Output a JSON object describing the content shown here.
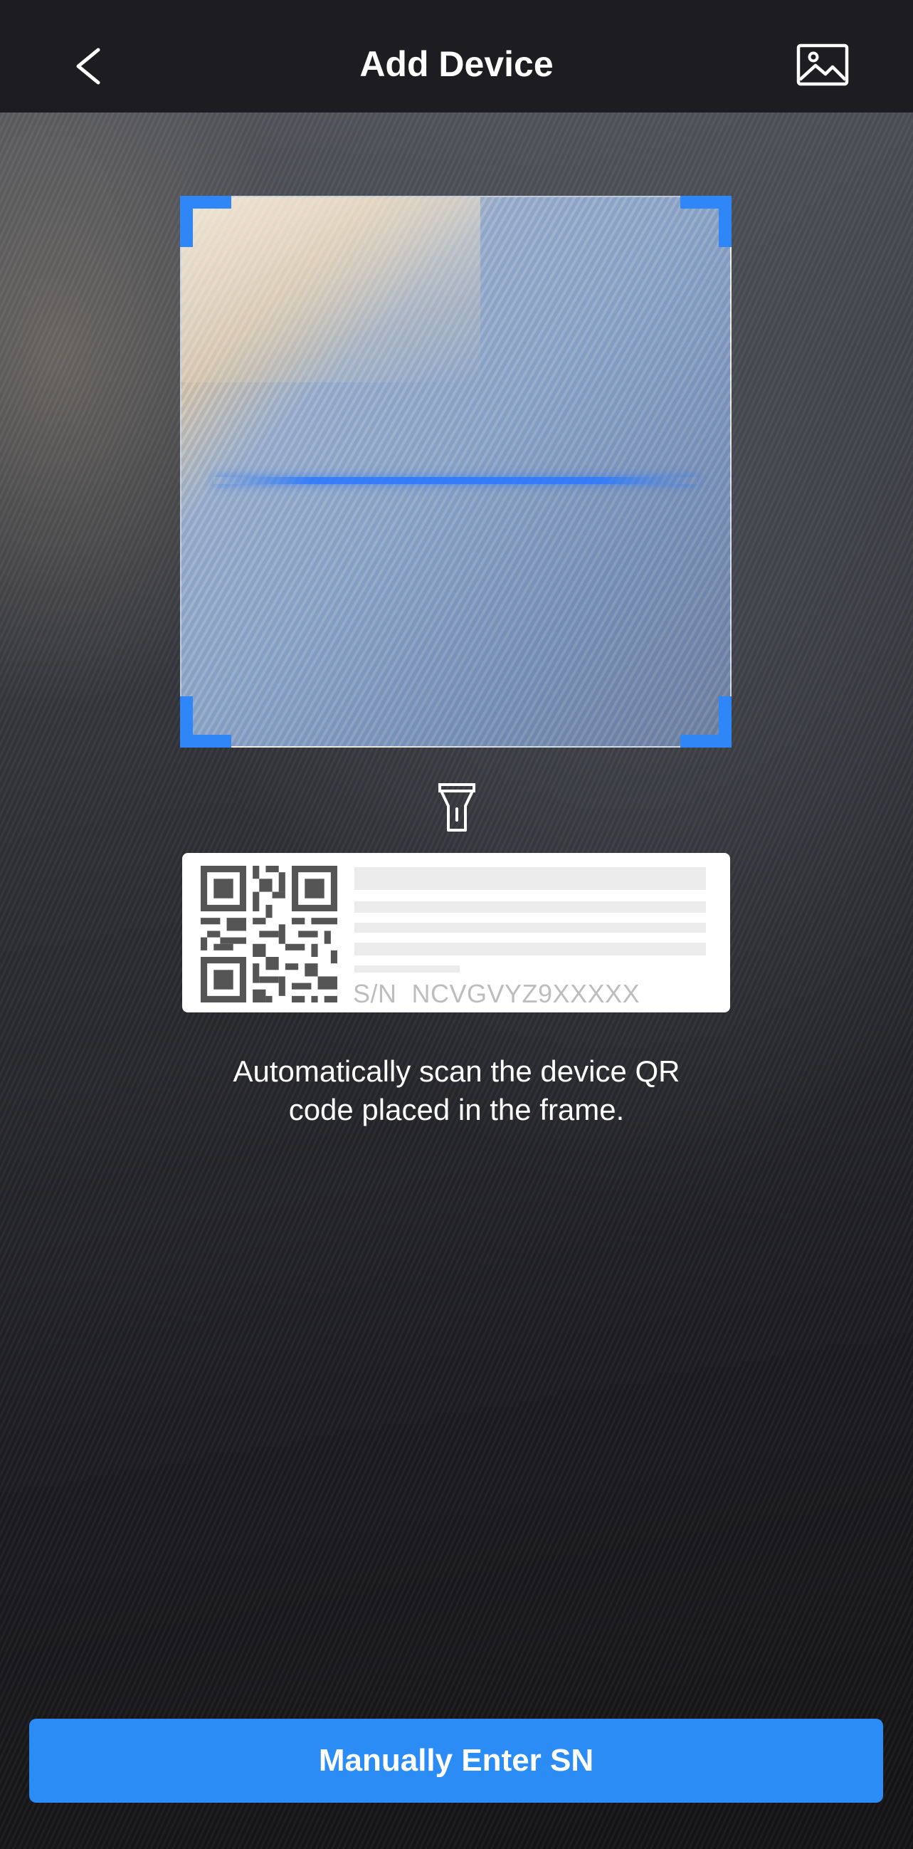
{
  "header": {
    "title": "Add Device",
    "back_icon": "chevron-left-icon",
    "gallery_icon": "image-icon"
  },
  "scanner": {
    "frame_color": "#2e86f7",
    "flashlight_icon": "flashlight-icon",
    "example_label": {
      "qr_icon": "qr-code-icon",
      "serial_text": "S/N  NCVGVYZ9XXXXX"
    },
    "instruction_line1": "Automatically scan the device QR",
    "instruction_line2": "code placed in the frame."
  },
  "footer": {
    "manual_button_label": "Manually Enter SN",
    "button_color": "#2b8cf5"
  }
}
